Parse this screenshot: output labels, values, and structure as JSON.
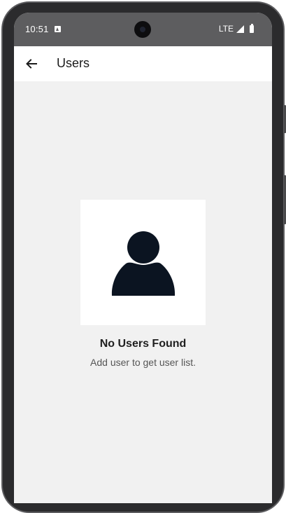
{
  "status_bar": {
    "time": "10:51",
    "network": "LTE",
    "notification_icon": "notification-icon",
    "signal_icon": "signal-icon",
    "battery_icon": "battery-icon"
  },
  "app_bar": {
    "back_icon": "arrow-back-icon",
    "title": "Users"
  },
  "empty_state": {
    "icon": "person-icon",
    "title": "No Users Found",
    "subtitle": "Add user to get user list."
  },
  "colors": {
    "background": "#f1f1f1",
    "status_bar": "#5d5d5f",
    "icon": "#0b1421"
  }
}
